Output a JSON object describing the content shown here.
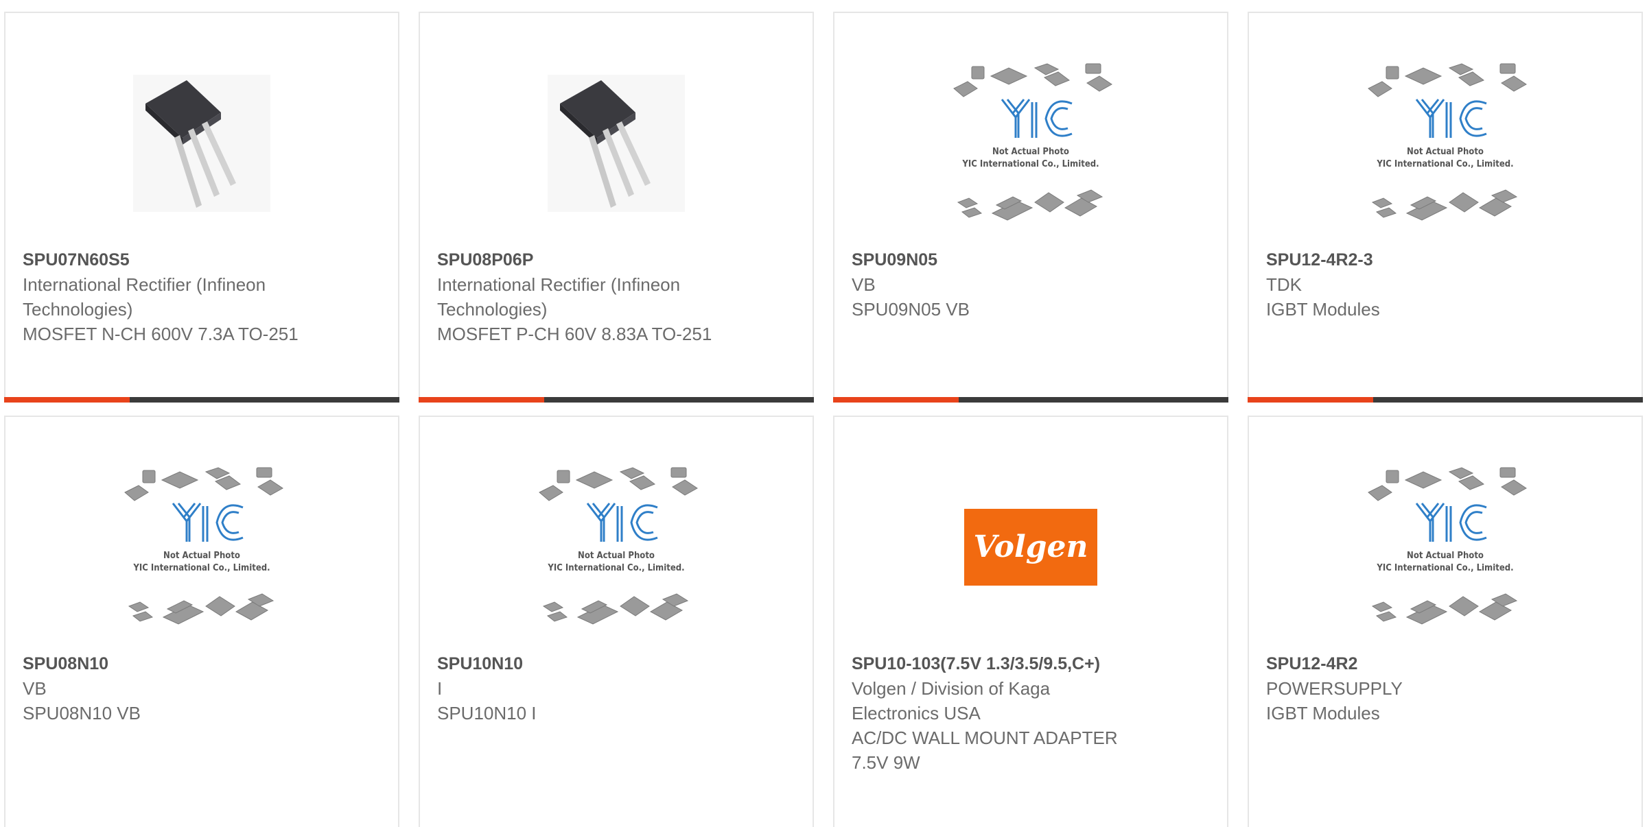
{
  "colors": {
    "accent": "#e8431b",
    "bar": "#3b3b3b",
    "border": "#e6e6e6",
    "yic_blue": "#2f7fc8",
    "volgen_orange": "#f26a10"
  },
  "placeholder": {
    "line1": "Not Actual Photo",
    "line2": "YIC International Co., Limited.",
    "logo": "YIC"
  },
  "products": [
    {
      "part": "SPU07N60S5",
      "manufacturer": "International Rectifier (Infineon Technologies)",
      "description": "MOSFET N-CH 600V 7.3A TO-251",
      "image": "to-251-package-photo"
    },
    {
      "part": "SPU08P06P",
      "manufacturer": "International Rectifier (Infineon Technologies)",
      "description": "MOSFET P-CH 60V 8.83A TO-251",
      "image": "to-251-package-photo"
    },
    {
      "part": "SPU09N05",
      "manufacturer": "VB",
      "description": "SPU09N05 VB",
      "image": "yic-placeholder"
    },
    {
      "part": "SPU12-4R2-3",
      "manufacturer": "TDK",
      "description": "IGBT Modules",
      "image": "yic-placeholder"
    },
    {
      "part": "SPU08N10",
      "manufacturer": "VB",
      "description": "SPU08N10 VB",
      "image": "yic-placeholder"
    },
    {
      "part": "SPU10N10",
      "manufacturer": "I",
      "description": "SPU10N10 I",
      "image": "yic-placeholder"
    },
    {
      "part": "SPU10-103(7.5V 1.3/3.5/9.5,C+)",
      "manufacturer": "Volgen / Division of Kaga Electronics USA",
      "description": "AC/DC WALL MOUNT ADAPTER 7.5V 9W",
      "image": "volgen-logo",
      "logo_text": "Volgen"
    },
    {
      "part": "SPU12-4R2",
      "manufacturer": "POWERSUPPLY",
      "description": "IGBT Modules",
      "image": "yic-placeholder"
    }
  ]
}
